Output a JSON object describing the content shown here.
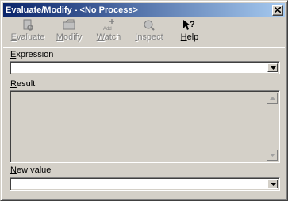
{
  "window": {
    "title": "Evaluate/Modify - <No Process>"
  },
  "toolbar": {
    "evaluate": {
      "label": "Evaluate",
      "key": "E",
      "rest": "valuate",
      "enabled": false,
      "icon": "evaluate-icon"
    },
    "modify": {
      "label": "Modify",
      "key": "M",
      "rest": "odify",
      "enabled": false,
      "icon": "modify-icon"
    },
    "watch": {
      "label": "Watch",
      "key": "W",
      "rest": "atch",
      "enabled": false,
      "icon": "add-watch-icon",
      "icon_text": "Add"
    },
    "inspect": {
      "label": "Inspect",
      "key": "I",
      "rest": "nspect",
      "enabled": false,
      "icon": "inspect-icon"
    },
    "help": {
      "label": "Help",
      "key": "H",
      "rest": "elp",
      "enabled": true,
      "icon": "help-pointer-icon"
    }
  },
  "expression": {
    "label": "Expression",
    "key": "E",
    "rest": "xpression",
    "value": ""
  },
  "result": {
    "label": "Result",
    "key": "R",
    "rest": "esult",
    "value": ""
  },
  "new_value": {
    "label": "New value",
    "key": "N",
    "rest": "ew value",
    "value": ""
  },
  "colors": {
    "title_start": "#0a246a",
    "title_end": "#a6caf0",
    "face": "#d4d0c8"
  }
}
